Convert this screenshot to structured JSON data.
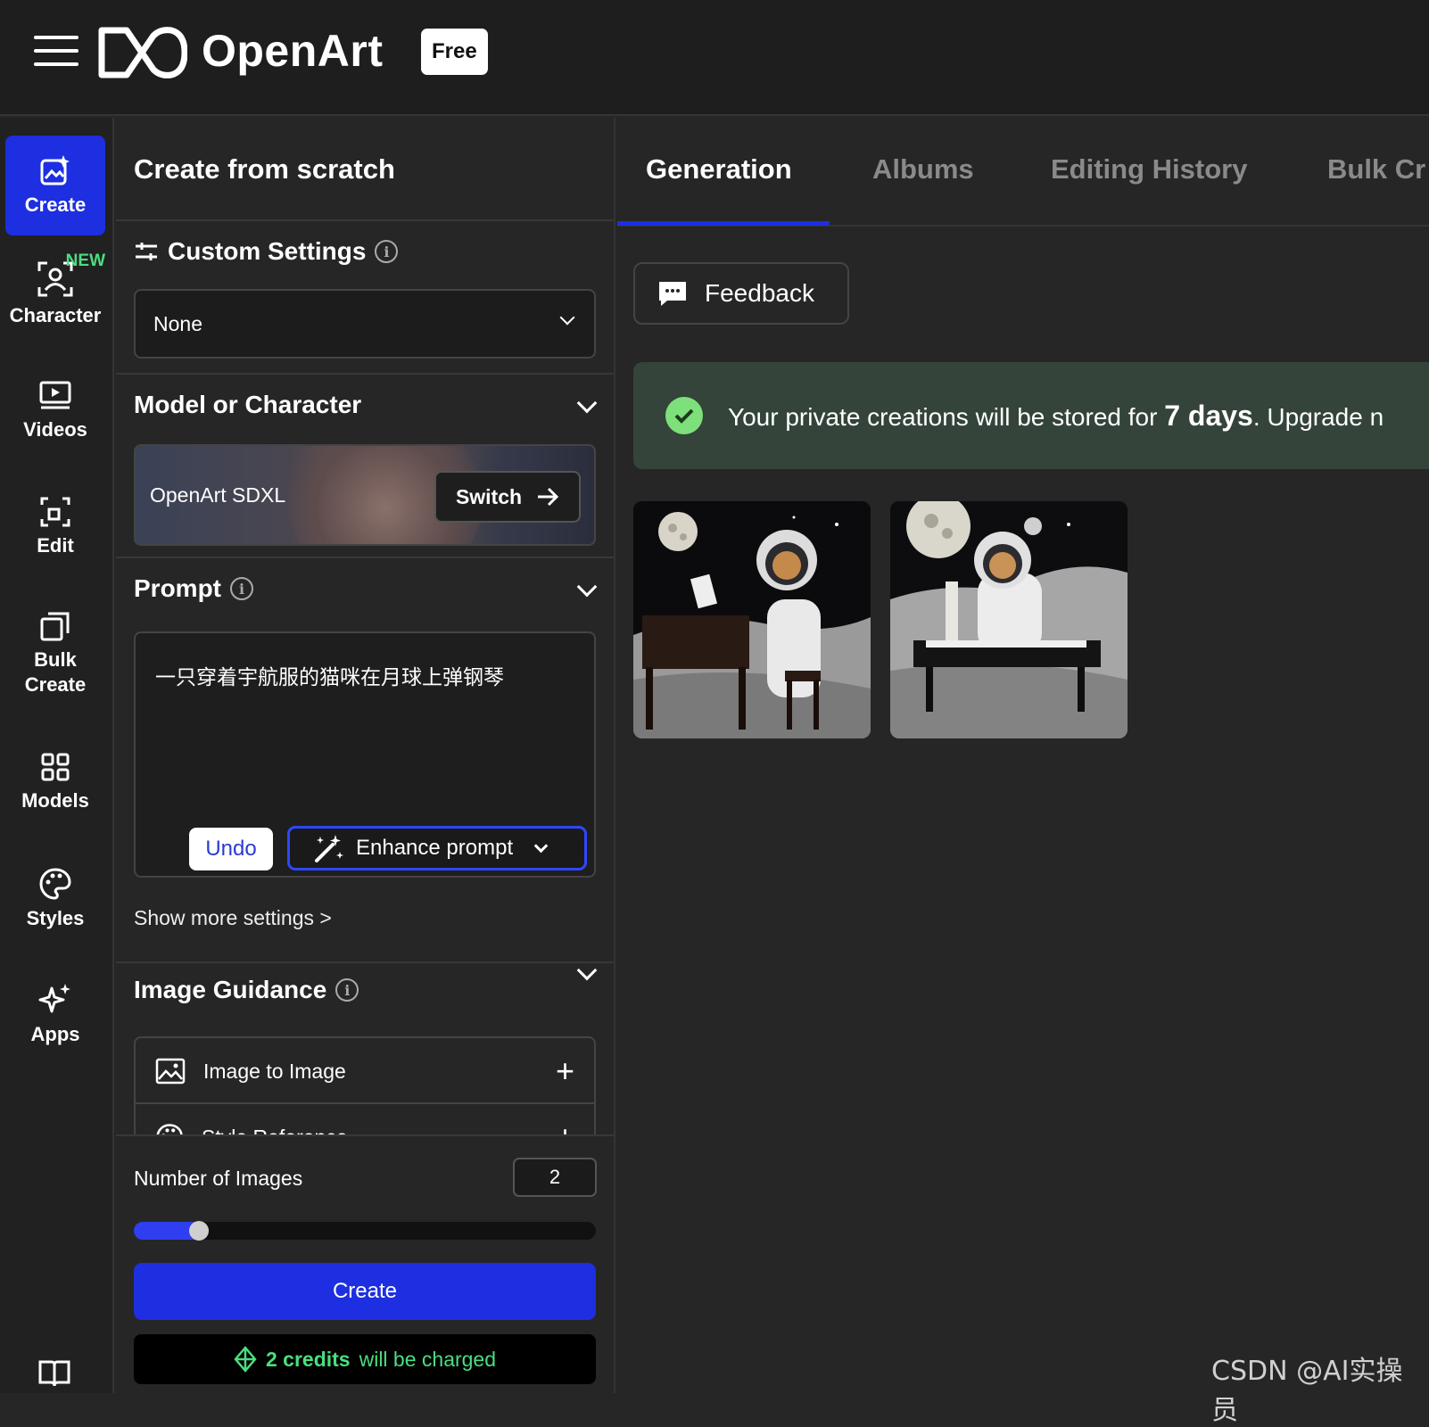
{
  "header": {
    "brand": "OpenArt",
    "badge": "Free"
  },
  "nav": {
    "create": "Create",
    "character": "Character",
    "character_tag": "NEW",
    "videos": "Videos",
    "edit": "Edit",
    "bulk_line1": "Bulk",
    "bulk_line2": "Create",
    "models": "Models",
    "styles": "Styles",
    "apps": "Apps"
  },
  "panel": {
    "title": "Create from scratch",
    "custom_settings": {
      "title": "Custom Settings",
      "value": "None"
    },
    "model": {
      "title": "Model or Character",
      "name": "OpenArt SDXL",
      "switch_label": "Switch"
    },
    "prompt": {
      "title": "Prompt",
      "text": "一只穿着宇航服的猫咪在月球上弹钢琴",
      "undo": "Undo",
      "enhance": "Enhance prompt"
    },
    "show_more": "Show more settings >",
    "image_guidance": {
      "title": "Image Guidance",
      "items": [
        "Image to Image",
        "Style Reference"
      ]
    },
    "number_of_images": {
      "label": "Number of Images",
      "value": "2",
      "slider_fraction": 0.14
    },
    "create_button": "Create",
    "credits": {
      "amount": "2 credits",
      "suffix": "will be charged"
    }
  },
  "main": {
    "tabs": [
      "Generation",
      "Albums",
      "Editing History",
      "Bulk Cr"
    ],
    "feedback": "Feedback",
    "notice": {
      "pre": "Your private creations will be stored for",
      "bold": "7 days",
      "post": ". Upgrade n"
    }
  },
  "watermark": "CSDN @AI实操员",
  "colors": {
    "accent": "#1d2fe0",
    "success": "#4ade80",
    "notice_bg": "#34443a"
  }
}
